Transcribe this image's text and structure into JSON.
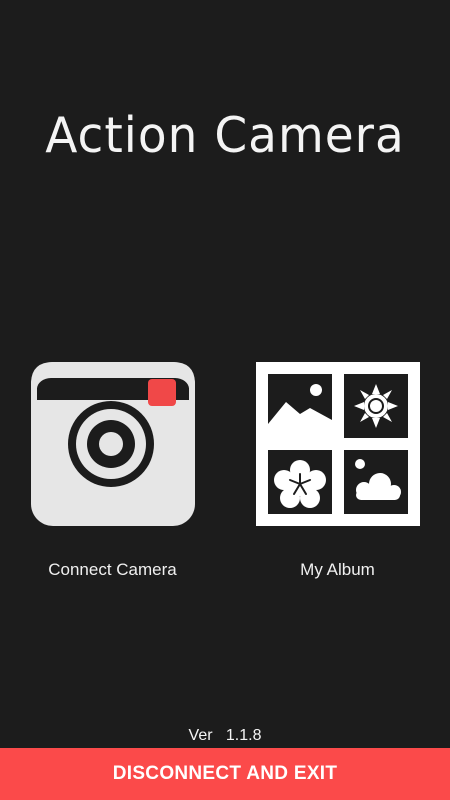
{
  "app": {
    "title": "Action Camera"
  },
  "tiles": [
    {
      "label": "Connect Camera",
      "icon": "camera-icon"
    },
    {
      "label": "My Album",
      "icon": "album-icon"
    }
  ],
  "footer": {
    "version": "Ver   1.1.8",
    "exit_button_label": "DISCONNECT AND EXIT"
  },
  "colors": {
    "background": "#1c1c1c",
    "accent": "#fb4a4a",
    "camera_body": "#e6e6e6",
    "camera_record_dot": "#f04848"
  }
}
